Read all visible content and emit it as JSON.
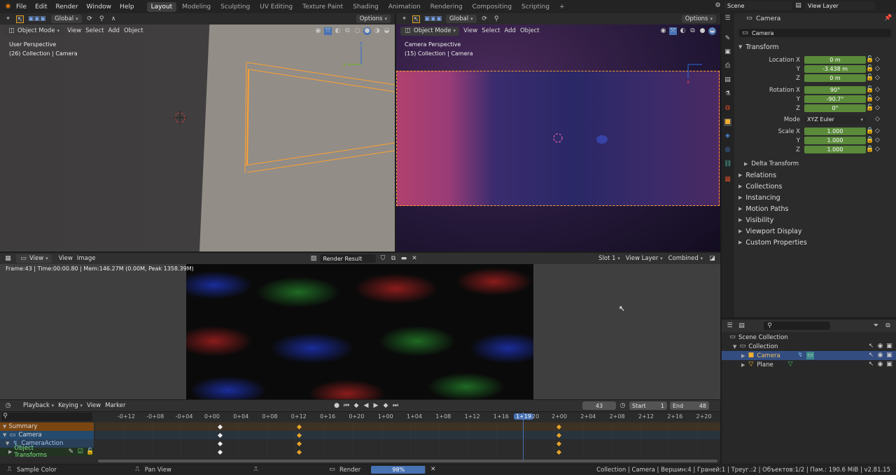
{
  "topbar": {
    "menus": [
      "File",
      "Edit",
      "Render",
      "Window",
      "Help"
    ],
    "workspaces": [
      "Layout",
      "Modeling",
      "Sculpting",
      "UV Editing",
      "Texture Paint",
      "Shading",
      "Animation",
      "Rendering",
      "Compositing",
      "Scripting"
    ],
    "active_workspace": "Layout",
    "add_tab": "+",
    "scene": "Scene",
    "view_layer": "View Layer"
  },
  "viewport_left": {
    "transform_orientation": "Global",
    "options": "Options",
    "mode": "Object Mode",
    "menus": [
      "View",
      "Select",
      "Add",
      "Object"
    ],
    "perspective": "User Perspective",
    "collection_info": "(26) Collection | Camera"
  },
  "viewport_right": {
    "transform_orientation": "Global",
    "options": "Options",
    "mode": "Object Mode",
    "menus": [
      "View",
      "Select",
      "Add",
      "Object"
    ],
    "perspective": "Camera Perspective",
    "collection_info": "(15) Collection | Camera"
  },
  "image_editor": {
    "view_label": "View",
    "menus": [
      "View",
      "Image"
    ],
    "image_name": "Render Result",
    "slot": "Slot 1",
    "view_layer": "View Layer",
    "pass": "Combined",
    "frame_info": "Frame:43 | Time:00:00.80 | Mem:146.27M (0.00M, Peak 1358.39M)"
  },
  "properties": {
    "object_name": "Camera",
    "data_name": "Camera",
    "transform_title": "Transform",
    "location": {
      "label": "Location X",
      "x": "0 m",
      "y": "-3.438 m",
      "z": "0 m"
    },
    "rotation": {
      "label": "Rotation X",
      "x": "90°",
      "y": "-90.7°",
      "z": "0°"
    },
    "mode_label": "Mode",
    "mode_value": "XYZ Euler",
    "scale": {
      "label": "Scale X",
      "x": "1.000",
      "y": "1.000",
      "z": "1.000"
    },
    "axis_y": "Y",
    "axis_z": "Z",
    "delta_transform": "Delta Transform",
    "sections": [
      "Relations",
      "Collections",
      "Instancing",
      "Motion Paths",
      "Visibility",
      "Viewport Display",
      "Custom Properties"
    ]
  },
  "outliner": {
    "scene_collection": "Scene Collection",
    "collection": "Collection",
    "camera": "Camera",
    "plane": "Plane"
  },
  "timeline": {
    "menus": [
      "Playback",
      "Keying",
      "View",
      "Marker"
    ],
    "current_frame": "43",
    "start_label": "Start",
    "start_value": "1",
    "end_label": "End",
    "end_value": "48",
    "ruler": [
      "-0+12",
      "-0+08",
      "-0+04",
      "0+00",
      "0+04",
      "0+08",
      "0+12",
      "0+16",
      "0+20",
      "1+00",
      "1+04",
      "1+08",
      "1+12",
      "1+16",
      "1+19",
      "20",
      "2+00",
      "2+04",
      "2+08",
      "2+12",
      "2+16",
      "2+20"
    ],
    "channels": {
      "summary": "Summary",
      "camera": "Camera",
      "action": "CameraAction",
      "transforms": "Object Transforms"
    }
  },
  "statusbar": {
    "sample_color": "Sample Color",
    "pan_view": "Pan View",
    "render_label": "Render",
    "render_progress": "98%",
    "progress_fraction": 0.98,
    "stats": "Collection | Camera | Вершин:4 | Граней:1 | Треуг.:2 | Объектов:1/2 | Пам.: 190.6 MiB | v2.81.15"
  },
  "colors": {
    "accent_blue": "#4772b3",
    "field_green": "#5a8a3a",
    "keyframe": "#e8a52a",
    "selection_orange": "#ffa030"
  }
}
